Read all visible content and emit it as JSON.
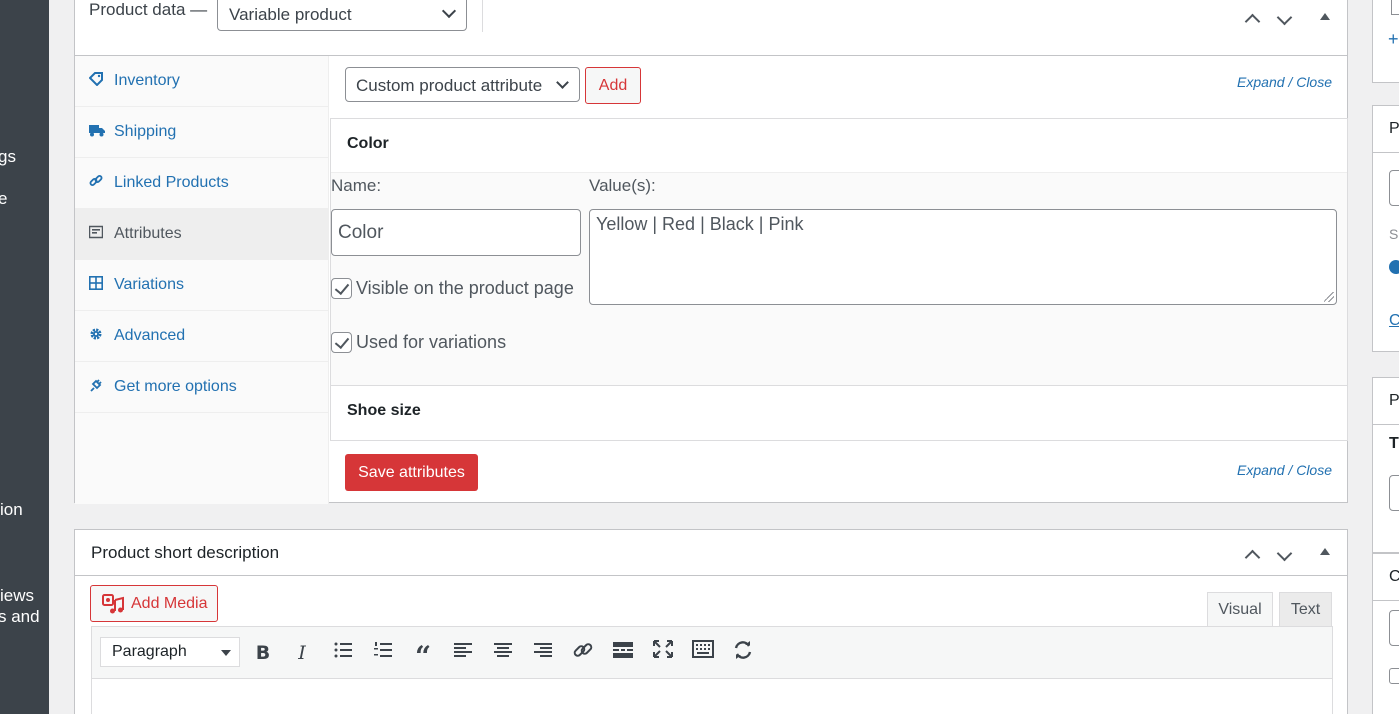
{
  "admin_menu": {
    "fragments": [
      "gs",
      "e",
      "ion",
      "iews",
      "s and"
    ]
  },
  "product_data": {
    "title": "Product data —",
    "type_value": "Variable product",
    "tabs": [
      {
        "label": "Inventory",
        "icon": "tag-icon"
      },
      {
        "label": "Shipping",
        "icon": "truck-icon"
      },
      {
        "label": "Linked Products",
        "icon": "link-icon"
      },
      {
        "label": "Attributes",
        "icon": "list-icon"
      },
      {
        "label": "Variations",
        "icon": "grid-icon"
      },
      {
        "label": "Advanced",
        "icon": "gear-icon"
      },
      {
        "label": "Get more options",
        "icon": "plugin-icon"
      }
    ],
    "active_tab": "Attributes",
    "attribute_select": "Custom product attribute",
    "add_label": "Add",
    "expand_label": "Expand",
    "sep": "/",
    "close_label": "Close",
    "attributes": [
      {
        "heading": "Color",
        "name_label": "Name:",
        "values_label": "Value(s):",
        "name_value": "Color",
        "values_value": "Yellow | Red | Black | Pink",
        "visible_label": "Visible on the product page",
        "variations_label": "Used for variations"
      },
      {
        "heading": "Shoe size"
      }
    ],
    "save_label": "Save attributes"
  },
  "short_description": {
    "title": "Product short description",
    "add_media_label": "Add Media",
    "tab_visual": "Visual",
    "tab_text": "Text",
    "format_select": "Paragraph",
    "toolbar_icons": [
      "bold-icon",
      "italic-icon",
      "bullet-list-icon",
      "numbered-list-icon",
      "blockquote-icon",
      "align-left-icon",
      "align-center-icon",
      "align-right-icon",
      "insert-link-icon",
      "read-more-icon",
      "fullscreen-icon",
      "toolbar-toggle-icon",
      "undo-icon"
    ]
  },
  "right_sidebar": {
    "fragments": [
      "+",
      "P",
      "S",
      "C",
      "P",
      "T",
      "C"
    ]
  },
  "colors": {
    "accent_link": "#2271b1",
    "button_red": "#d63638",
    "admin_menu_bg": "#3c434a"
  }
}
